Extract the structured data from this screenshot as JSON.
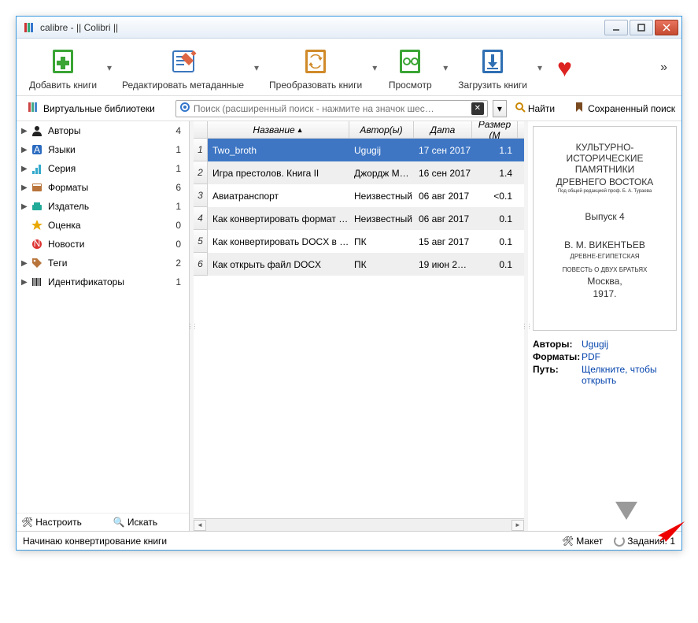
{
  "window": {
    "title": "calibre - || Colibri ||"
  },
  "toolbar": [
    {
      "label": "Добавить книги",
      "icon": "add-books",
      "color": "#3aa535"
    },
    {
      "label": "Редактировать метаданные",
      "icon": "edit-meta",
      "color": "#3b77bd"
    },
    {
      "label": "Преобразовать книги",
      "icon": "convert",
      "color": "#d08a2a"
    },
    {
      "label": "Просмотр",
      "icon": "view",
      "color": "#3aa535"
    },
    {
      "label": "Загрузить книги",
      "icon": "download",
      "color": "#2f6fb3"
    }
  ],
  "virtual_libraries_label": "Виртуальные библиотеки",
  "search": {
    "placeholder": "Поиск (расширенный поиск - нажмите на значок шес…",
    "find_label": "Найти",
    "saved_label": "Сохраненный поиск"
  },
  "sidebar": {
    "items": [
      {
        "label": "Авторы",
        "count": 4,
        "icon": "person",
        "expandable": true
      },
      {
        "label": "Языки",
        "count": 1,
        "icon": "lang",
        "expandable": true
      },
      {
        "label": "Серия",
        "count": 1,
        "icon": "series",
        "expandable": true
      },
      {
        "label": "Форматы",
        "count": 6,
        "icon": "formats",
        "expandable": true
      },
      {
        "label": "Издатель",
        "count": 1,
        "icon": "publisher",
        "expandable": true
      },
      {
        "label": "Оценка",
        "count": 0,
        "icon": "rating",
        "expandable": false
      },
      {
        "label": "Новости",
        "count": 0,
        "icon": "news",
        "expandable": false
      },
      {
        "label": "Теги",
        "count": 2,
        "icon": "tags",
        "expandable": true
      },
      {
        "label": "Идентификаторы",
        "count": 1,
        "icon": "ids",
        "expandable": true
      }
    ],
    "configure_label": "Настроить",
    "search_label": "Искать"
  },
  "columns": {
    "title": "Название",
    "author": "Автор(ы)",
    "date": "Дата",
    "size": "Размер (М"
  },
  "books": [
    {
      "n": 1,
      "title": "Two_broth",
      "author": "Ugugij",
      "date": "17 сен 2017",
      "size": "1.1",
      "selected": true
    },
    {
      "n": 2,
      "title": "Игра престолов. Книга II",
      "author": "Джордж М…",
      "date": "16 сен 2017",
      "size": "1.4"
    },
    {
      "n": 3,
      "title": "Авиатранспорт",
      "author": "Неизвестный",
      "date": "06 авг 2017",
      "size": "<0.1"
    },
    {
      "n": 4,
      "title": "Как конвертировать формат …",
      "author": "Неизвестный",
      "date": "06 авг 2017",
      "size": "0.1"
    },
    {
      "n": 5,
      "title": "Как конвертировать DOCX в …",
      "author": "ПК",
      "date": "15 авг 2017",
      "size": "0.1"
    },
    {
      "n": 6,
      "title": "Как открыть файл DOCX",
      "author": "ПК",
      "date": "19 июн 2…",
      "size": "0.1"
    }
  ],
  "cover": {
    "l1": "КУЛЬТУРНО-ИСТОРИЧЕСКИЕ ПАМЯТНИКИ",
    "l2": "ДРЕВНЕГО ВОСТОКА",
    "l3": "Под общей редакцией проф. Б. А. Тураева",
    "l4": "Выпуск 4",
    "l5": "В. М. ВИКЕНТЬЕВ",
    "l6": "ДРЕВНЕ-ЕГИПЕТСКАЯ",
    "l7": "ПОВЕСТЬ О ДВУХ БРАТЬЯХ",
    "l8": "Москва,",
    "l9": "1917."
  },
  "details": {
    "authors_label": "Авторы:",
    "authors_val": "Ugugij",
    "formats_label": "Форматы:",
    "formats_val": "PDF",
    "path_label": "Путь:",
    "path_val": "Щелкните, чтобы открыть"
  },
  "status": {
    "text": "Начинаю конвертирование книги",
    "layout_label": "Макет",
    "jobs_label": "Задания: 1"
  }
}
